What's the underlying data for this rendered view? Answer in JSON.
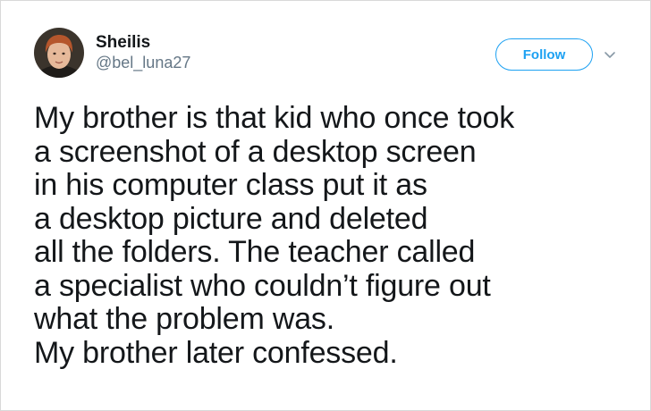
{
  "user": {
    "display_name": "Sheilis",
    "handle": "@bel_luna27",
    "avatar": "profile-photo"
  },
  "actions": {
    "follow_label": "Follow",
    "menu_icon": "chevron-down-icon"
  },
  "colors": {
    "accent": "#1da1f2",
    "text": "#14171a",
    "secondary_text": "#657786",
    "border": "#d9d9d9"
  },
  "tweet": {
    "lines": [
      "My brother is that kid who once took",
      "a screenshot of a desktop screen",
      "in his computer class put it as",
      "a desktop picture and deleted",
      "all the folders. The teacher called",
      "a specialist who couldn’t figure out",
      "what the problem was.",
      "My brother later confessed."
    ]
  }
}
